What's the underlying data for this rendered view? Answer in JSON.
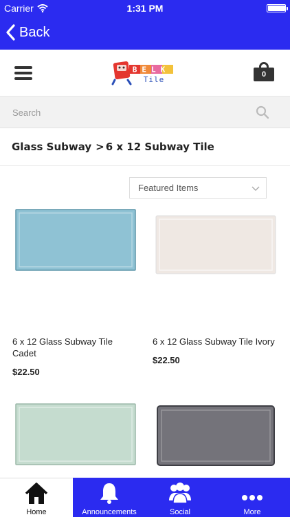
{
  "status_bar": {
    "carrier": "Carrier",
    "time": "1:31 PM",
    "battery_level": 0.95
  },
  "nav": {
    "back_label": "Back"
  },
  "header": {
    "logo_text_top": "BELK",
    "logo_text_bottom": "Tile",
    "cart_count": "0"
  },
  "search": {
    "placeholder": "Search"
  },
  "breadcrumb": {
    "parent": "Glass Subway",
    "separator": ">",
    "current": "6 x 12 Subway Tile"
  },
  "sort": {
    "selected": "Featured Items"
  },
  "products": [
    {
      "name": "6 x 12 Glass Subway Tile Cadet",
      "price": "$22.50",
      "color": "#8fc2d4"
    },
    {
      "name": "6 x 12 Glass Subway Tile Ivory",
      "price": "$22.50",
      "color": "#efe8e3"
    },
    {
      "name": "",
      "price": "",
      "color": "#c5dccf"
    },
    {
      "name": "",
      "price": "",
      "color": "#74737a"
    }
  ],
  "tabs": [
    {
      "label": "Home",
      "icon": "home-icon"
    },
    {
      "label": "Announcements",
      "icon": "bell-icon"
    },
    {
      "label": "Social",
      "icon": "people-icon"
    },
    {
      "label": "More",
      "icon": "more-icon"
    }
  ],
  "colors": {
    "brand_blue": "#2b2bf0"
  }
}
